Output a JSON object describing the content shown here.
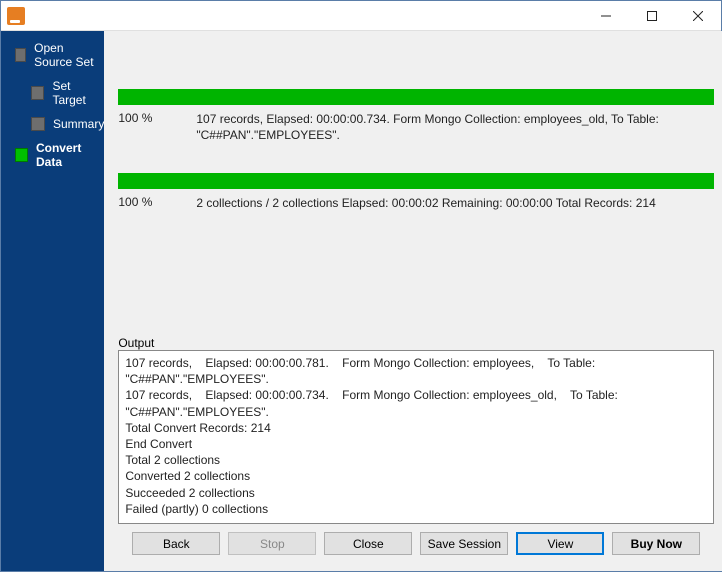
{
  "sidebar": {
    "steps": [
      {
        "label": "Open Source Set",
        "level": "root",
        "active": false
      },
      {
        "label": "Set Target",
        "level": "child",
        "active": false
      },
      {
        "label": "Summary",
        "level": "child",
        "active": false
      },
      {
        "label": "Convert Data",
        "level": "root",
        "active": true
      }
    ]
  },
  "progress1": {
    "percent": "100 %",
    "text": "107 records,    Elapsed: 00:00:00.734.    Form Mongo Collection: employees_old,    To Table: \"C##PAN\".\"EMPLOYEES\"."
  },
  "progress2": {
    "percent": "100 %",
    "text": "2 collections / 2 collections    Elapsed: 00:00:02    Remaining: 00:00:00    Total Records: 214"
  },
  "output": {
    "label": "Output",
    "text": "107 records,    Elapsed: 00:00:00.781.    Form Mongo Collection: employees,    To Table: \"C##PAN\".\"EMPLOYEES\".\n107 records,    Elapsed: 00:00:00.734.    Form Mongo Collection: employees_old,    To Table: \"C##PAN\".\"EMPLOYEES\".\nTotal Convert Records: 214\nEnd Convert\nTotal 2 collections\nConverted 2 collections\nSucceeded 2 collections\nFailed (partly) 0 collections"
  },
  "buttons": {
    "back": "Back",
    "stop": "Stop",
    "close": "Close",
    "save_session": "Save Session",
    "view": "View",
    "buy_now": "Buy Now"
  }
}
